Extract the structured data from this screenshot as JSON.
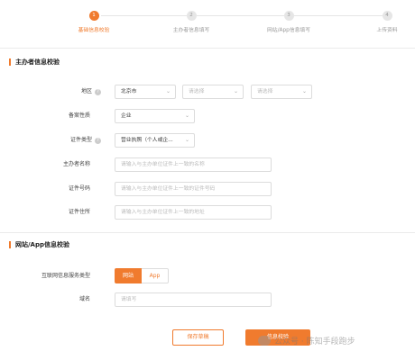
{
  "steps": [
    {
      "num": "1",
      "label": "基础信息校验"
    },
    {
      "num": "2",
      "label": "主办者信息填写"
    },
    {
      "num": "3",
      "label": "网站/App信息填写"
    },
    {
      "num": "4",
      "label": "上传资料"
    }
  ],
  "colors": {
    "accent": "#f07b2e"
  },
  "section1": {
    "title": "主办者信息校验",
    "region_label": "地区",
    "region_province": "北京市",
    "region_city_placeholder": "请选择",
    "region_district_placeholder": "请选择",
    "nature_label": "备案性质",
    "nature_value": "企业",
    "cert_type_label": "证件类型",
    "cert_type_value": "营业执照（个人或企...",
    "holder_name_label": "主办者名称",
    "holder_name_placeholder": "请输入与主办单位证件上一致的名称",
    "cert_no_label": "证件号码",
    "cert_no_placeholder": "请输入与主办单位证件上一致的证件号码",
    "cert_addr_label": "证件住所",
    "cert_addr_placeholder": "请输入与主办单位证件上一致的地址"
  },
  "section2": {
    "title": "网站/App信息校验",
    "service_type_label": "互联网信息服务类型",
    "service_type_options": [
      "网站",
      "App"
    ],
    "domain_label": "域名",
    "domain_placeholder": "请填写"
  },
  "actions": {
    "save_label": "保存草稿",
    "verify_label": "信息校验"
  },
  "watermark": {
    "text": "公众号 · 陈知手段跑步"
  }
}
